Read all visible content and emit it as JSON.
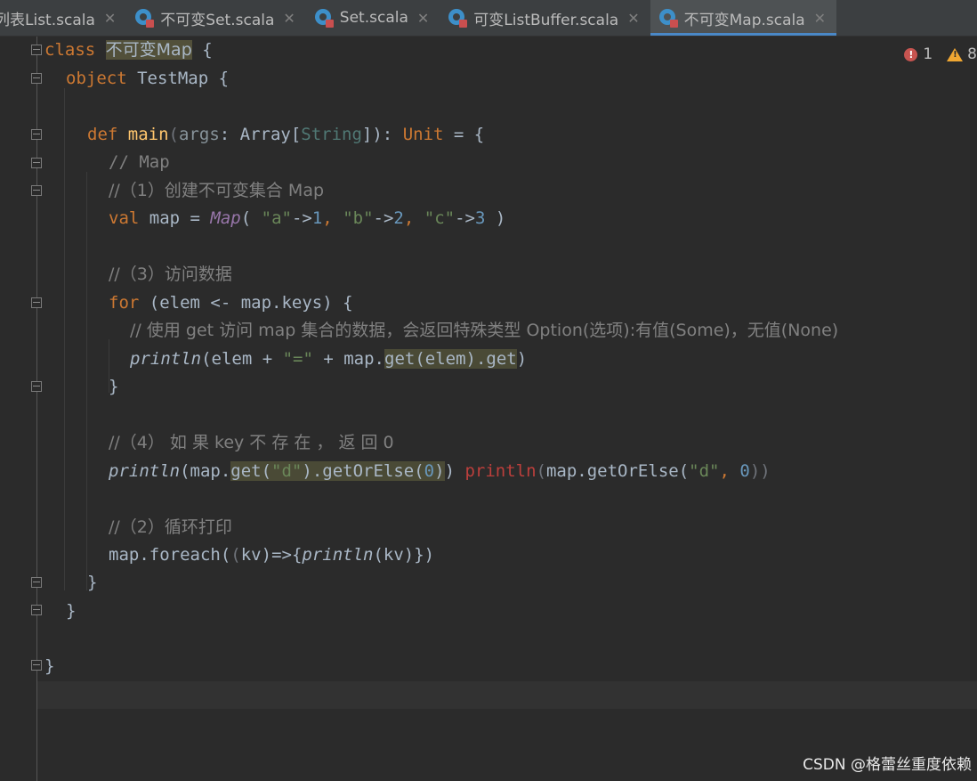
{
  "tabs": [
    {
      "label": "列表List.scala",
      "icon": "none",
      "active": false
    },
    {
      "label": "不可变Set.scala",
      "icon": "scala-file-icon",
      "active": false
    },
    {
      "label": "Set.scala",
      "icon": "scala-file-icon",
      "active": false
    },
    {
      "label": "可变ListBuffer.scala",
      "icon": "scala-file-icon",
      "active": false
    },
    {
      "label": "不可变Map.scala",
      "icon": "scala-file-icon",
      "active": true
    }
  ],
  "tab_close_glyph": "✕",
  "indicators": {
    "errors": "1",
    "warnings": "8"
  },
  "code": {
    "l1": {
      "kw": "class",
      "name": "不可变Map",
      "rest": " {"
    },
    "l2": {
      "kw": "object",
      "rest": " TestMap {"
    },
    "l3": {
      "kw": "def",
      "fn": "main",
      "p1": "(",
      "param": "args",
      "p2": ": Array[",
      "type": "String",
      "p3": "]): ",
      "unit": "Unit",
      "p4": " = {"
    },
    "l4": "// Map",
    "l5": "//（1）创建不可变集合 Map",
    "l6": {
      "kw": "val",
      "a": " map = ",
      "map": "Map",
      "b": "( ",
      "s1": "\"a\"",
      "c": "->",
      "n1": "1",
      "d": ", ",
      "s2": "\"b\"",
      "e": "->",
      "n2": "2",
      "f": ", ",
      "s3": "\"c\"",
      "g": "->",
      "n3": "3",
      "h": " )"
    },
    "l7": "//（3）访问数据",
    "l8": {
      "kw": "for",
      "rest": " (elem <- map.keys) {"
    },
    "l9": "// 使用 get 访问 map 集合的数据，会返回特殊类型 Option(选项):有值(Some)，无值(None)",
    "l10": {
      "fn": "println",
      "a": "(elem + ",
      "s": "\"=\"",
      "b": " + map.",
      "g": "get(elem).get",
      "c": ")"
    },
    "l11": "}",
    "l12": "//（4） 如 果 key 不 存 在 ， 返 回 0",
    "l13": {
      "fn": "println",
      "a": "(map.",
      "g1": "get(",
      "s": "\"d\"",
      "g2": ").getOrElse(",
      "n": "0",
      "g3": ")",
      "b": ")",
      "err1": " println",
      "e2": "(",
      "e3": "map.getOrElse(",
      "e4": "\"d\"",
      "e5": ", ",
      "e6": "0",
      "e7": "))"
    },
    "l14": "//（2）循环打印",
    "l15": {
      "a": "map.foreach(",
      "b": "(",
      "c": "kv",
      "d": ")=>{",
      "fn": "println",
      "e": "(kv)})"
    },
    "l16": "}",
    "l17": "}",
    "l18": "}"
  },
  "watermark": "CSDN @格蕾丝重度依赖"
}
